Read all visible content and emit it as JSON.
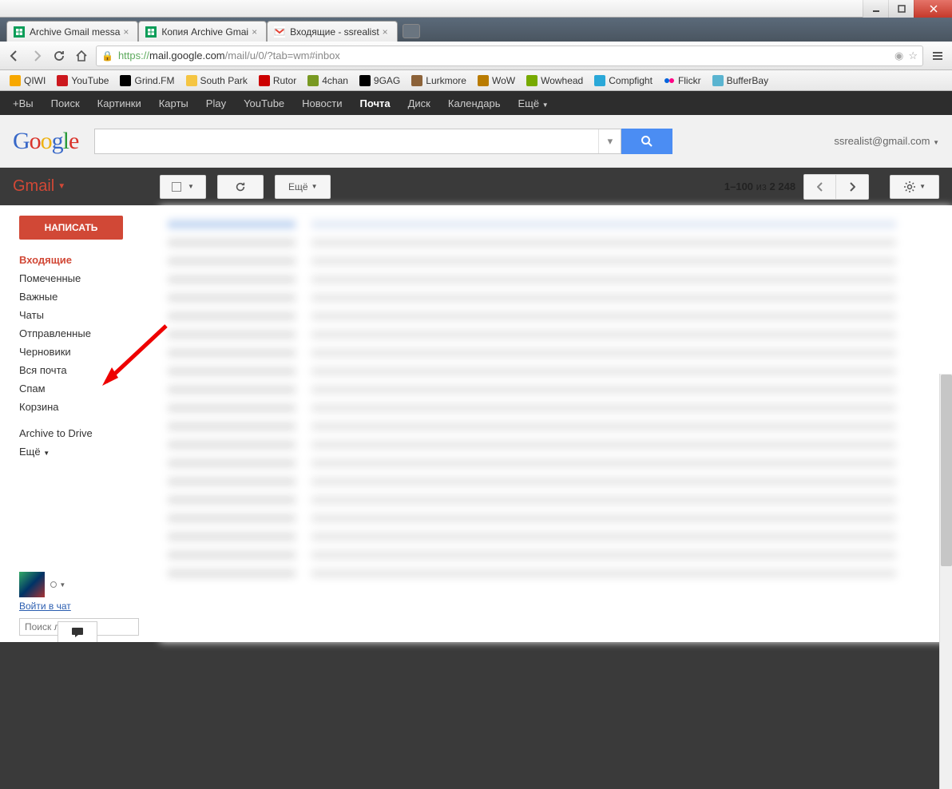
{
  "window": {
    "controls": {
      "minimize": "minimize",
      "maximize": "maximize",
      "close": "close"
    }
  },
  "tabs": [
    {
      "label": "Archive Gmail messa",
      "icon_color": "#0a9d58"
    },
    {
      "label": "Копия Archive Gmai",
      "icon_color": "#0a9d58"
    },
    {
      "label": "Входящие - ssrealist",
      "icon_color": "#e34133"
    }
  ],
  "url": {
    "scheme": "https://",
    "host": "mail.google.com",
    "path": "/mail/u/0/?tab=wm#inbox"
  },
  "bookmarks": [
    {
      "label": "QIWI",
      "color": "#f7a800"
    },
    {
      "label": "YouTube",
      "color": "#cc181e"
    },
    {
      "label": "Grind.FM",
      "color": "#000"
    },
    {
      "label": "South Park",
      "color": "#f5c542"
    },
    {
      "label": "Rutor",
      "color": "#c00"
    },
    {
      "label": "4chan",
      "color": "#789922"
    },
    {
      "label": "9GAG",
      "color": "#000"
    },
    {
      "label": "Lurkmore",
      "color": "#8c6239"
    },
    {
      "label": "WoW",
      "color": "#b97b00"
    },
    {
      "label": "Wowhead",
      "color": "#7a0"
    },
    {
      "label": "Compfight",
      "color": "#2aa8d8"
    },
    {
      "label": "Flickr",
      "color": "#ff0084"
    },
    {
      "label": "BufferBay",
      "color": "#5ab4d0"
    }
  ],
  "gbar": {
    "items": [
      "+Вы",
      "Поиск",
      "Картинки",
      "Карты",
      "Play",
      "YouTube",
      "Новости",
      "Почта",
      "Диск",
      "Календарь",
      "Ещё"
    ],
    "active": "Почта"
  },
  "account": {
    "email": "ssrealist@gmail.com"
  },
  "gmail": {
    "label": "Gmail",
    "compose": "НАПИСАТЬ",
    "toolbar": {
      "more": "Ещё"
    },
    "pager": {
      "range": "1–100",
      "of": "из",
      "total": "2 248"
    },
    "nav": [
      {
        "label": "Входящие",
        "active": true
      },
      {
        "label": "Помеченные"
      },
      {
        "label": "Важные"
      },
      {
        "label": "Чаты"
      },
      {
        "label": "Отправленные"
      },
      {
        "label": "Черновики"
      },
      {
        "label": "Вся почта"
      },
      {
        "label": "Спам"
      },
      {
        "label": "Корзина"
      }
    ],
    "labels": [
      {
        "label": "Archive to Drive"
      },
      {
        "label": "Ещё"
      }
    ],
    "chat": {
      "login": "Войти в чат",
      "search_placeholder": "Поиск людей..."
    }
  }
}
